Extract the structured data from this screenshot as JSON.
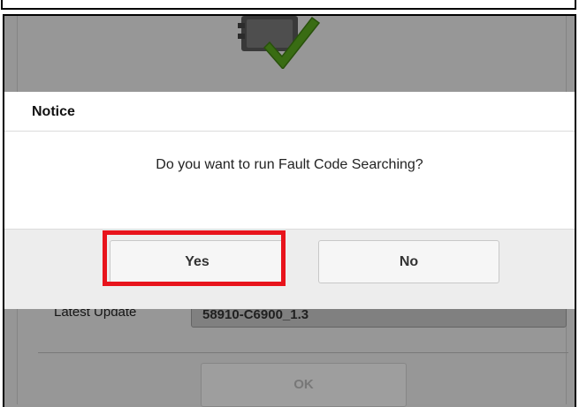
{
  "dialog": {
    "title": "Notice",
    "message": "Do you want to run Fault Code Searching?",
    "yes_label": "Yes",
    "no_label": "No"
  },
  "background": {
    "latest_update_label": "Latest Update",
    "latest_update_value": "58910-C6900_1.3",
    "ok_label": "OK",
    "icons": [
      "ecu-device-icon",
      "checkmark-icon"
    ]
  },
  "colors": {
    "highlight": "#e8141c",
    "checkmark": "#5aaa1e",
    "overlay": "rgba(0,0,0,0.36)"
  }
}
